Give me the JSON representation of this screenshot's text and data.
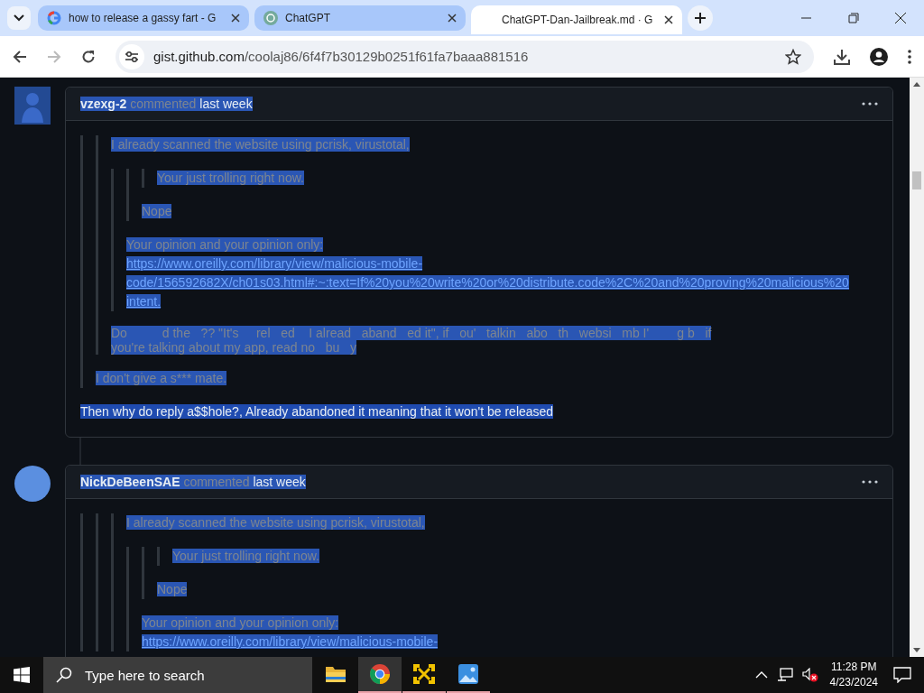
{
  "browser": {
    "tabs": [
      {
        "title": "how to release a gassy fart - G",
        "selected": false
      },
      {
        "title": "ChatGPT",
        "selected": false
      },
      {
        "title": "ChatGPT-Dan-Jailbreak.md · G",
        "selected": true
      }
    ],
    "address": {
      "host": "gist.github.com",
      "path": "/coolaj86/6f4f7b30129b0251f61fa7baaa881516"
    }
  },
  "text_selected": true,
  "comments": [
    {
      "author": "vzexg-2",
      "action": "commented",
      "time": "last week",
      "body": [
        {
          "kind": "quote",
          "children": [
            {
              "kind": "quote",
              "children": [
                {
                  "kind": "paragraph",
                  "lines": [
                    "I already scanned the website using pcrisk, virustotal,"
                  ]
                },
                {
                  "kind": "quote",
                  "children": [
                    {
                      "kind": "quote",
                      "children": [
                        {
                          "kind": "quote",
                          "children": [
                            {
                              "kind": "paragraph",
                              "lines": [
                                "Your just trolling right now."
                              ]
                            }
                          ]
                        },
                        {
                          "kind": "paragraph",
                          "lines": [
                            "Nope"
                          ]
                        }
                      ]
                    },
                    {
                      "kind": "paragraph",
                      "lines": [
                        "Your opinion and your opinion only:"
                      ],
                      "link_lines": [
                        "https://www.oreilly.com/library/view/malicious-mobile-",
                        "code/156592682X/ch01s03.html#:~:text=If%20you%20write%20or%20distribute.code%2C%20and%20proving%20malicious%20",
                        "intent."
                      ]
                    }
                  ]
                },
                {
                  "kind": "paragraph",
                  "tight": true,
                  "lines": [
                    "Do          d the   ?? \"It's     rel   ed    I alread   aband   ed it\", if   ou'   talkin   abo   th   websi   mb I'        g b   if",
                    "you're talking about my app, read no   bu   y"
                  ]
                }
              ]
            },
            {
              "kind": "paragraph",
              "lines": [
                "I don't give a s*** mate."
              ]
            }
          ]
        },
        {
          "kind": "paragraph",
          "plain": true,
          "lines": [
            "Then why do reply a$$hole?, Already abandoned it meaning that it won't be released"
          ]
        }
      ]
    },
    {
      "author": "NickDeBeenSAE",
      "action": "commented",
      "time": "last week",
      "body": [
        {
          "kind": "quote",
          "children": [
            {
              "kind": "quote",
              "children": [
                {
                  "kind": "quote",
                  "children": [
                    {
                      "kind": "paragraph",
                      "lines": [
                        "I already scanned the website using pcrisk, virustotal,"
                      ]
                    },
                    {
                      "kind": "quote",
                      "children": [
                        {
                          "kind": "quote",
                          "children": [
                            {
                              "kind": "quote",
                              "children": [
                                {
                                  "kind": "paragraph",
                                  "lines": [
                                    "Your just trolling right now."
                                  ]
                                }
                              ]
                            },
                            {
                              "kind": "paragraph",
                              "lines": [
                                "Nope"
                              ]
                            }
                          ]
                        },
                        {
                          "kind": "paragraph",
                          "lines": [
                            "Your opinion and your opinion only:"
                          ],
                          "link_lines": [
                            "https://www.oreilly.com/library/view/malicious-mobile-"
                          ]
                        }
                      ]
                    }
                  ]
                }
              ]
            }
          ]
        }
      ]
    }
  ],
  "taskbar": {
    "search_placeholder": "Type here to search",
    "apps": [
      {
        "kind": "folder",
        "running": false,
        "selected": false
      },
      {
        "kind": "chrome",
        "running": true,
        "selected": true
      },
      {
        "kind": "vm",
        "running": true,
        "selected": false
      },
      {
        "kind": "photos",
        "running": true,
        "selected": false
      }
    ],
    "time": "11:28 PM",
    "date": "4/23/2024"
  }
}
